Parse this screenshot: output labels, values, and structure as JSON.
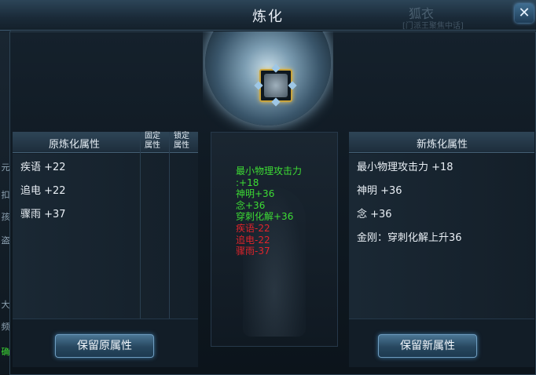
{
  "window": {
    "title": "炼化",
    "bg_ghost_title": "狐衣",
    "bg_ghost_subtitle": "[门派王聚焦中话]"
  },
  "left_strip": [
    "元",
    "扣",
    "孩",
    "盗",
    "大",
    "频",
    "确"
  ],
  "original": {
    "header": "原炼化属性",
    "col_fixed": "固定\n属性",
    "col_lock": "锁定\n属性",
    "rows": [
      "疾语 +22",
      "追电 +22",
      "骤雨 +37",
      "",
      "",
      "",
      ""
    ]
  },
  "new": {
    "header": "新炼化属性",
    "rows": [
      "最小物理攻击力 +18",
      "神明 +36",
      "念 +36",
      "金刚：穿刺化解上升36",
      "",
      "",
      ""
    ]
  },
  "diff": {
    "gains": [
      "最小物理攻击力",
      ":+18",
      "神明+36",
      "念+36",
      "穿刺化解+36"
    ],
    "losses": [
      "疾语-22",
      "追电-22",
      "骤雨-37"
    ]
  },
  "buttons": {
    "keep_original": "保留原属性",
    "keep_new": "保留新属性"
  },
  "colors": {
    "gain": "#3ddc34",
    "loss": "#e0242b",
    "slot_border": "#c8a33c"
  }
}
